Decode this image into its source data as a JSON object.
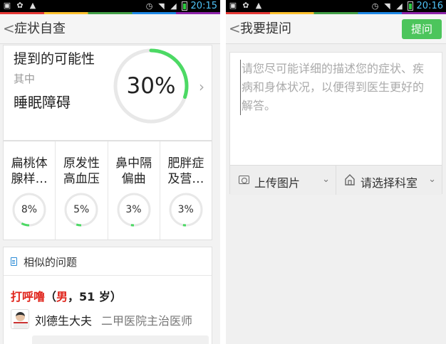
{
  "left": {
    "status": {
      "time": "20:15"
    },
    "nav": {
      "back": "<",
      "title": "症状自查"
    },
    "probability": {
      "title": "提到的可能性",
      "subtitle": "其中",
      "disease": "睡眠障碍",
      "value": 30,
      "label": "30%",
      "ring_color": "#4cd964"
    },
    "diseases": [
      {
        "name_line1": "扁桃体",
        "name_line2": "腺样…",
        "value": 8,
        "label": "8%"
      },
      {
        "name_line1": "原发性",
        "name_line2": "高血压",
        "value": 5,
        "label": "5%"
      },
      {
        "name_line1": "鼻中隔",
        "name_line2": "偏曲",
        "value": 3,
        "label": "3%"
      },
      {
        "name_line1": "肥胖症",
        "name_line2": "及营…",
        "value": 3,
        "label": "3%"
      }
    ],
    "similar": {
      "title": "相似的问题",
      "question_topic": "打呼噜",
      "question_open": "（",
      "question_gender": "男",
      "question_rest": "，51 岁）",
      "doctor_name": "刘德生大夫",
      "doctor_title": "二甲医院主治医师"
    }
  },
  "right": {
    "status": {
      "time": "20:16"
    },
    "nav": {
      "back": "<",
      "title": "我要提问",
      "ask_button": "提问"
    },
    "ask": {
      "placeholder": "请您尽可能详细的描述您的症状、疾病和身体状况，以便得到医生更好的解答。",
      "upload_label": "上传图片",
      "department_label": "请选择科室"
    }
  },
  "colors": {
    "accent_green": "#4cc55c",
    "alert_red": "#e0241b",
    "clip_blue": "#2a8bd6"
  },
  "icons": [
    "back-icon",
    "chevron-right-icon",
    "clipboard-icon",
    "camera-icon",
    "home-icon",
    "chevron-down-icon",
    "wifi-icon",
    "alarm-icon",
    "battery-icon"
  ]
}
